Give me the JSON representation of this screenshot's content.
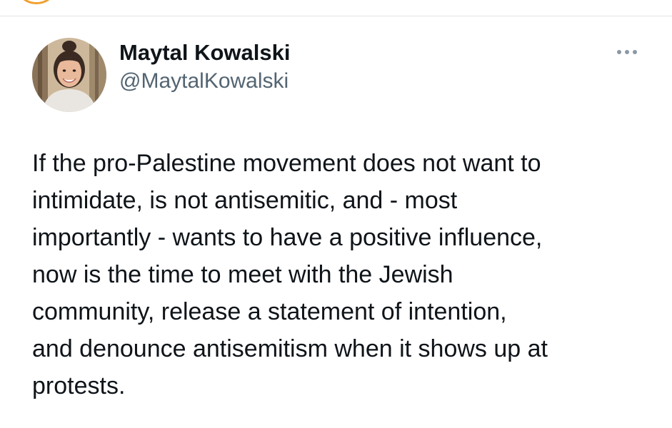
{
  "tweet": {
    "author": {
      "display_name": "Maytal Kowalski",
      "handle": "@MaytalKowalski",
      "avatar_icon": "profile-photo"
    },
    "more_icon": "more-horizontal-icon",
    "text": "If the pro-Palestine movement does not want to\nintimidate, is not antisemitic, and - most\nimportantly - wants to have a positive influence,\nnow is the time to meet with the Jewish\ncommunity, release a statement of intention,\nand denounce antisemitism when it shows up at\nprotests."
  },
  "colors": {
    "text_primary": "#0f1419",
    "text_secondary": "#536471",
    "divider": "#e1e4e8",
    "previous_avatar_ring": "#f0a030"
  }
}
